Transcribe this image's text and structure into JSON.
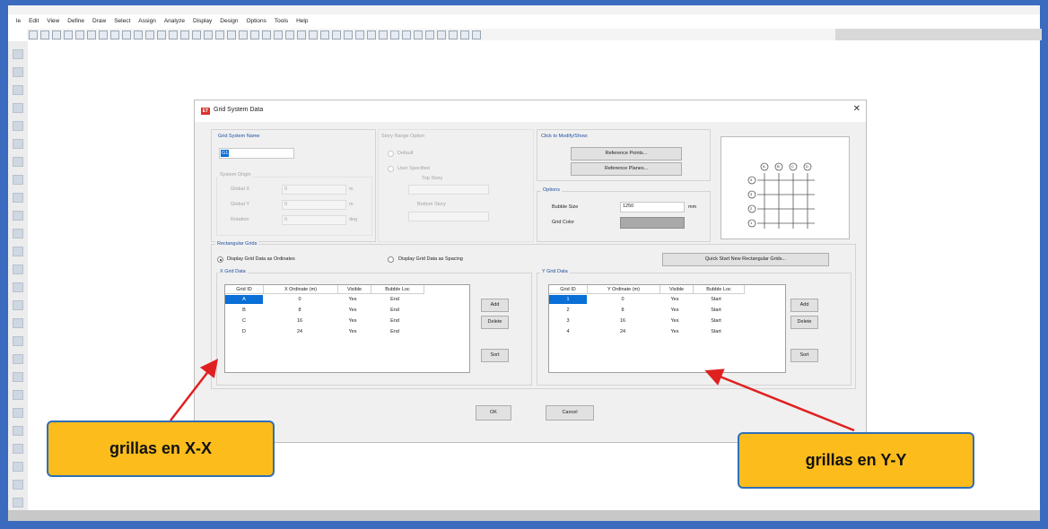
{
  "menu": [
    "le",
    "Edit",
    "View",
    "Define",
    "Draw",
    "Select",
    "Assign",
    "Analyze",
    "Display",
    "Design",
    "Options",
    "Tools",
    "Help"
  ],
  "dialog": {
    "title": "Grid System Data",
    "grid_system_name_label": "Grid System Name",
    "grid_system_name_value": "G1",
    "system_origin_label": "System Origin",
    "global_x_label": "Global X",
    "global_x_value": "0",
    "global_x_unit": "m",
    "global_y_label": "Global Y",
    "global_y_value": "0",
    "global_y_unit": "m",
    "rotation_label": "Rotation",
    "rotation_value": "0",
    "rotation_unit": "deg",
    "story_range_label": "Story Range Option",
    "default_label": "Default",
    "user_specified_label": "User Specified",
    "top_story_label": "Top Story",
    "bottom_story_label": "Bottom Story",
    "click_modify_label": "Click to Modify/Show:",
    "reference_points_btn": "Reference Points...",
    "reference_planes_btn": "Reference Planes...",
    "options_label": "Options",
    "bubble_size_label": "Bubble Size",
    "bubble_size_value": "1250",
    "bubble_size_unit": "mm",
    "grid_color_label": "Grid Color",
    "grid_color": "#a9a9a9",
    "rect_grids_label": "Rectangular Grids",
    "display_ordinates_label": "Display Grid Data as Ordinates",
    "display_spacing_label": "Display Grid Data as Spacing",
    "quick_start_btn": "Quick Start New Rectangular Grids...",
    "x_grid_label": "X Grid Data",
    "y_grid_label": "Y Grid Data",
    "x_headers": [
      "Grid ID",
      "X Ordinate (m)",
      "Visible",
      "Bubble Loc"
    ],
    "y_headers": [
      "Grid ID",
      "Y Ordinate (m)",
      "Visible",
      "Bubble Loc"
    ],
    "x_rows": [
      [
        "A",
        "0",
        "Yes",
        "End"
      ],
      [
        "B",
        "8",
        "Yes",
        "End"
      ],
      [
        "C",
        "16",
        "Yes",
        "End"
      ],
      [
        "D",
        "24",
        "Yes",
        "End"
      ]
    ],
    "y_rows": [
      [
        "1",
        "0",
        "Yes",
        "Start"
      ],
      [
        "2",
        "8",
        "Yes",
        "Start"
      ],
      [
        "3",
        "16",
        "Yes",
        "Start"
      ],
      [
        "4",
        "24",
        "Yes",
        "Start"
      ]
    ],
    "add_btn": "Add",
    "delete_btn": "Delete",
    "sort_btn": "Sort",
    "ok_btn": "OK",
    "cancel_btn": "Cancel",
    "preview_x_bubbles": [
      "A",
      "B",
      "C",
      "D"
    ],
    "preview_y_bubbles": [
      "4",
      "3",
      "2",
      "1"
    ]
  },
  "callouts": {
    "x": "grillas en X-X",
    "y": "grillas en Y-Y",
    "arrow_color": "#e02020",
    "fill_color": "#fbbc1c",
    "border_color": "#2f6fb6"
  }
}
